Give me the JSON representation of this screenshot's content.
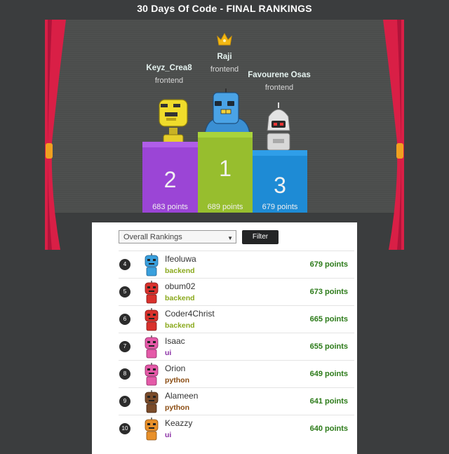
{
  "page": {
    "title": "30 Days Of Code - FINAL RANKINGS"
  },
  "podium": {
    "first": {
      "rank": "1",
      "name": "Raji",
      "team": "frontend",
      "points": "689 points",
      "color": "#97be2e"
    },
    "second": {
      "rank": "2",
      "name": "Keyz_Crea8",
      "team": "frontend",
      "points": "683 points",
      "color": "#9b45d6"
    },
    "third": {
      "rank": "3",
      "name": "Favourene Osas",
      "team": "frontend",
      "points": "679 points",
      "color": "#1e8bd5"
    }
  },
  "filter": {
    "selected": "Overall Rankings",
    "button_label": "Filter"
  },
  "team_colors": {
    "backend": "#8aa91c",
    "ui": "#8a2fa5",
    "python": "#8a4b10"
  },
  "rankings": [
    {
      "rank": "4",
      "name": "Ifeoluwa",
      "team": "backend",
      "points": "679 points",
      "avatar": "blue-robot-avatar"
    },
    {
      "rank": "5",
      "name": "obum02",
      "team": "backend",
      "points": "673 points",
      "avatar": "red-robot-avatar"
    },
    {
      "rank": "6",
      "name": "Coder4Christ",
      "team": "backend",
      "points": "665 points",
      "avatar": "red-robot-avatar"
    },
    {
      "rank": "7",
      "name": "Isaac",
      "team": "ui",
      "points": "655 points",
      "avatar": "pink-robot-avatar"
    },
    {
      "rank": "8",
      "name": "Orion",
      "team": "python",
      "points": "649 points",
      "avatar": "pink-robot-avatar"
    },
    {
      "rank": "9",
      "name": "Alameen",
      "team": "python",
      "points": "641 points",
      "avatar": "brown-robot-avatar"
    },
    {
      "rank": "10",
      "name": "Keazzy",
      "team": "ui",
      "points": "640 points",
      "avatar": "orange-robot-avatar"
    }
  ]
}
